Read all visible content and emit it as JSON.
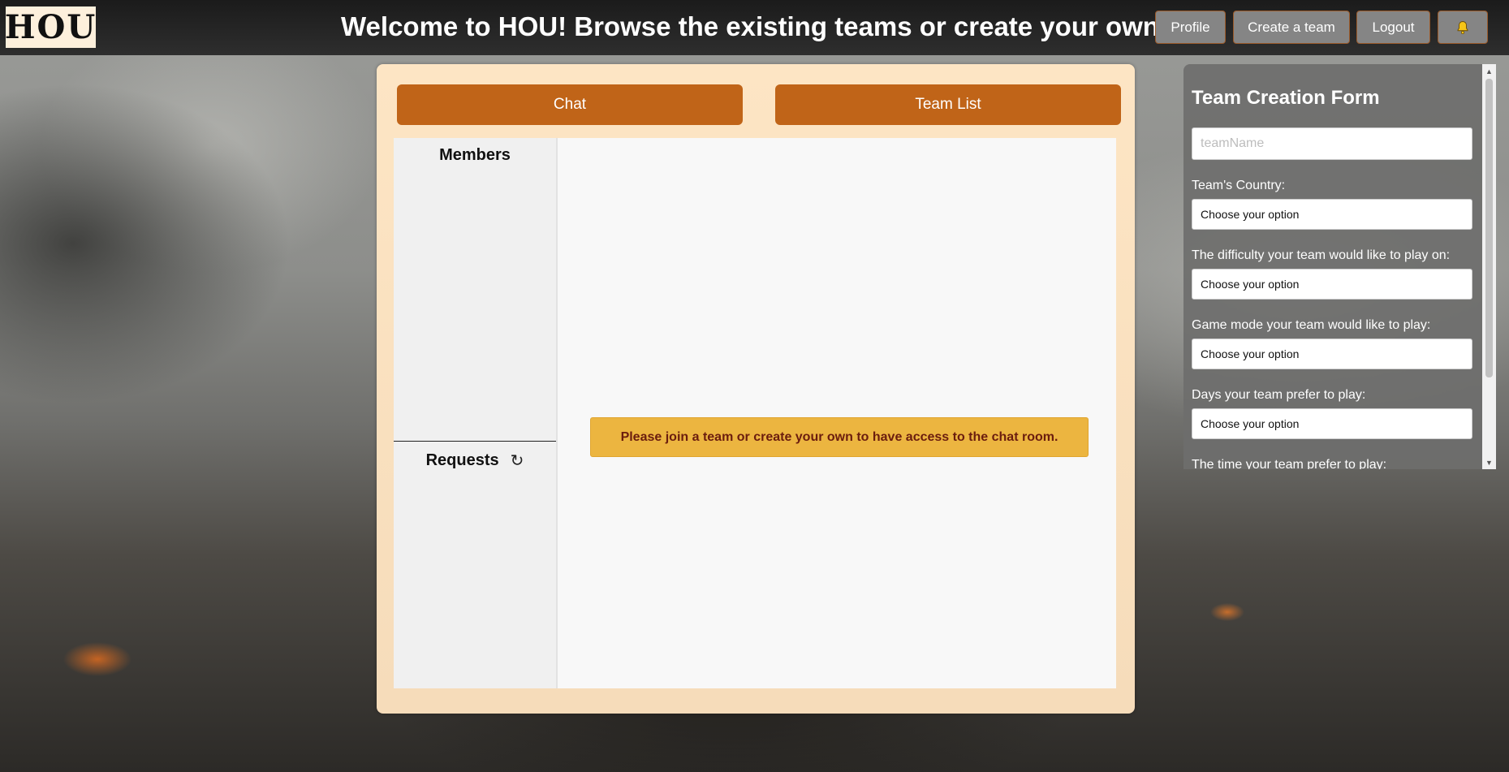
{
  "header": {
    "logo_text": "HOU",
    "title": "Welcome to HOU! Browse the existing teams or create your own",
    "profile_label": "Profile",
    "create_team_label": "Create a team",
    "logout_label": "Logout",
    "bell_icon": "bell-icon"
  },
  "main": {
    "tabs": {
      "chat_label": "Chat",
      "team_list_label": "Team List"
    },
    "members_title": "Members",
    "requests_title": "Requests",
    "refresh_icon": "↻",
    "notice": "Please join a team or create your own to have access to the chat room."
  },
  "form": {
    "title": "Team Creation Form",
    "team_name_placeholder": "teamName",
    "country_label": "Team's Country:",
    "country_value": "Choose your option",
    "difficulty_label": "The difficulty your team would like to play on:",
    "difficulty_value": "Choose your option",
    "mode_label": "Game mode your team would like to play:",
    "mode_value": "Choose your option",
    "days_label": "Days your team prefer to play:",
    "days_value": "Choose your option",
    "time_label": "The time your team prefer to play:"
  },
  "colors": {
    "accent_orange": "#c06418",
    "notice_bg": "#ecb540",
    "notice_text": "#6b1d0e",
    "panel_bg": "#fde5c4"
  }
}
